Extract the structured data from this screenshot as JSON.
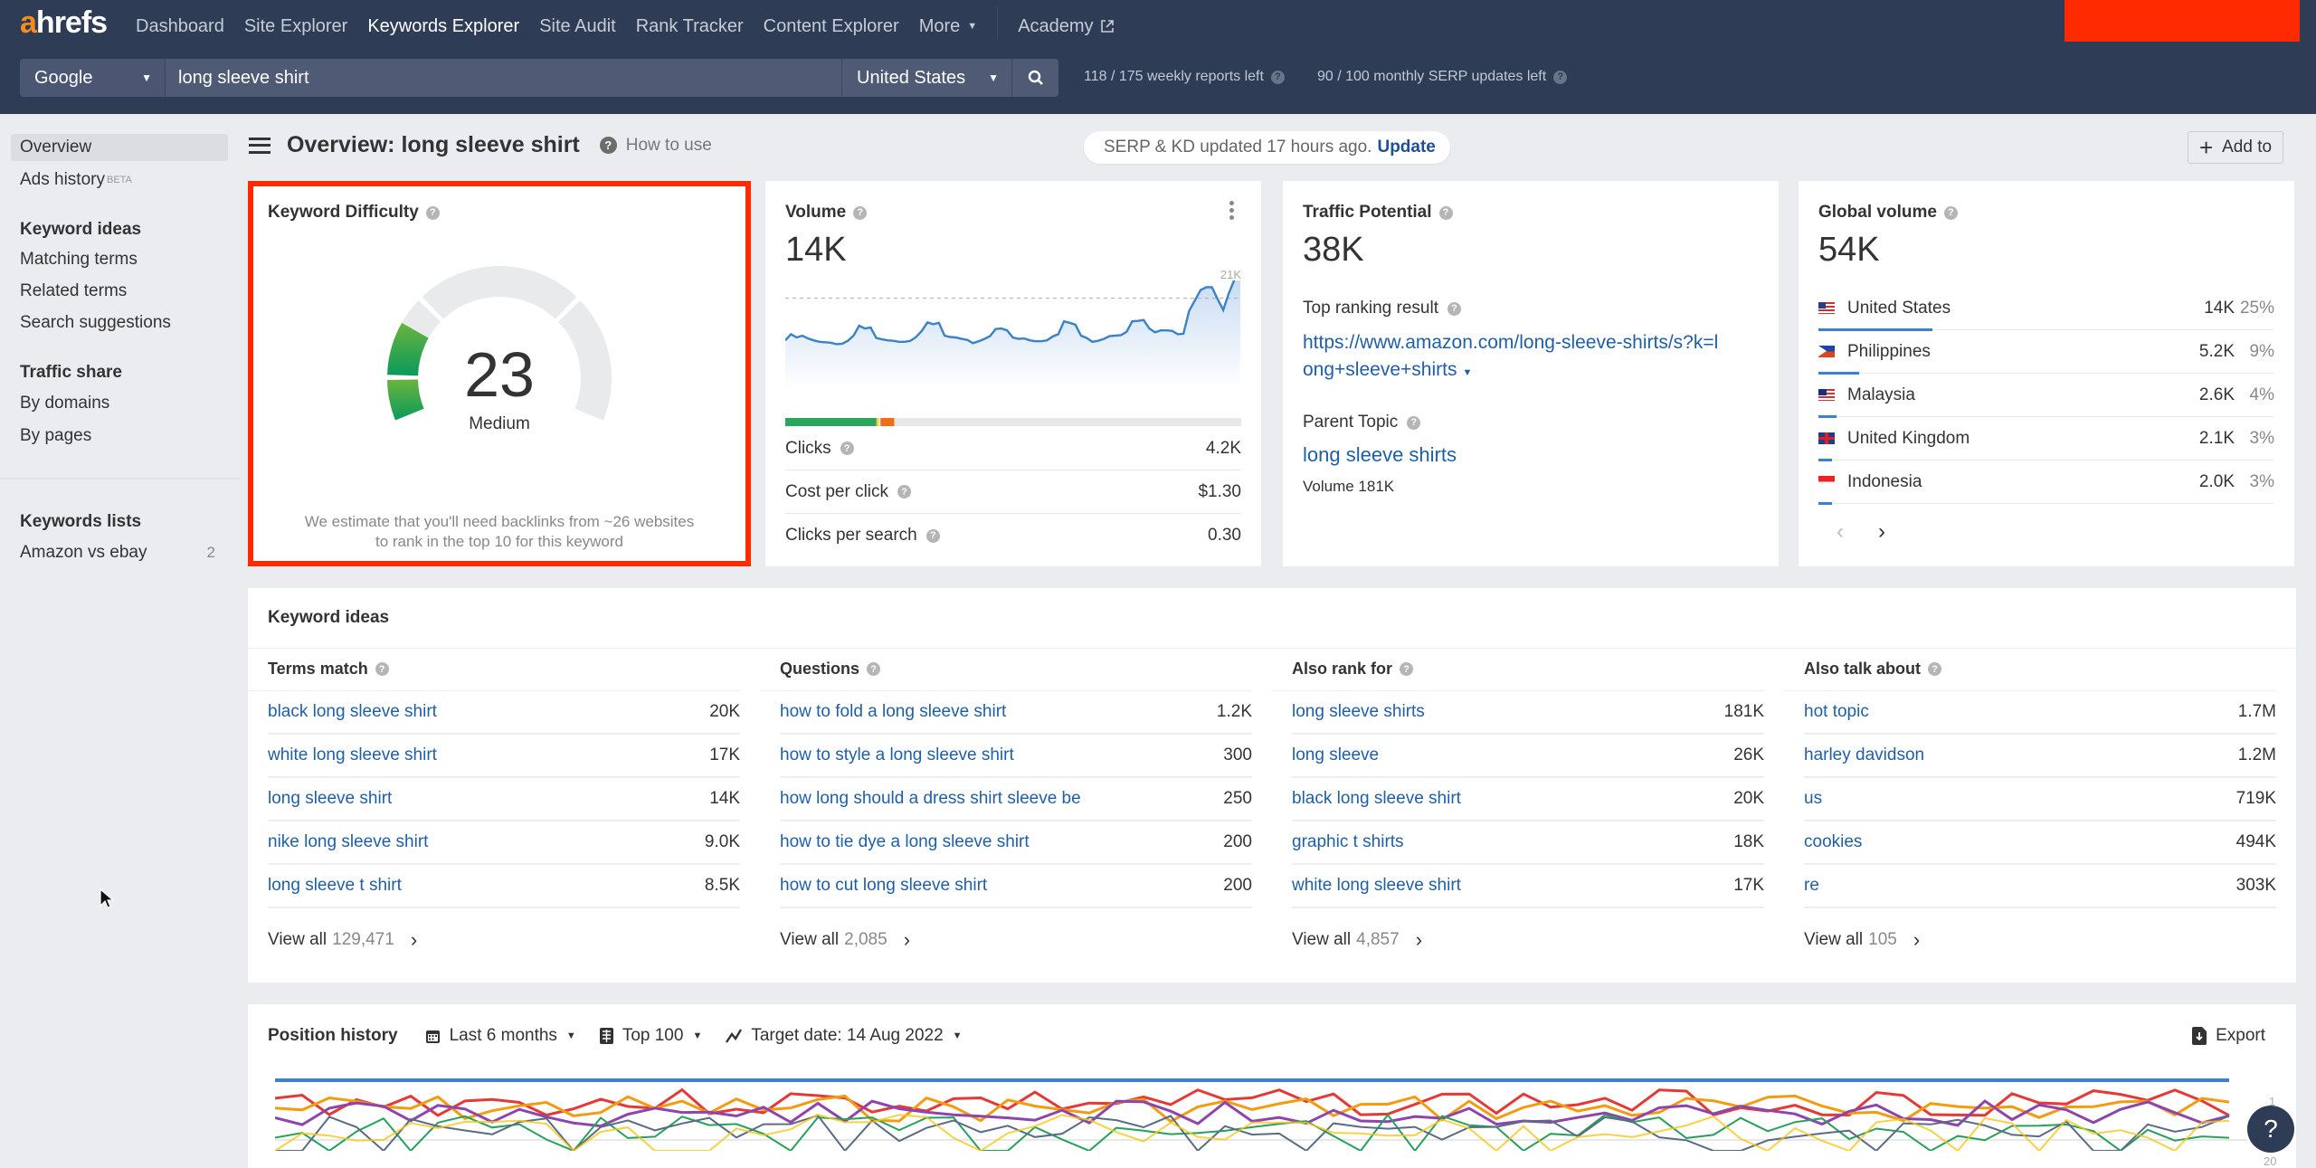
{
  "brand": {
    "logo_a": "a",
    "logo_rest": "hrefs"
  },
  "nav": {
    "items": [
      "Dashboard",
      "Site Explorer",
      "Keywords Explorer",
      "Site Audit",
      "Rank Tracker",
      "Content Explorer",
      "More"
    ],
    "active": "Keywords Explorer",
    "academy": "Academy"
  },
  "search": {
    "engine": "Google",
    "query": "long sleeve shirt",
    "country": "United States"
  },
  "quota": {
    "weekly": "118 / 175 weekly reports left",
    "monthly": "90 / 100 monthly SERP updates left"
  },
  "sidebar": {
    "overview": "Overview",
    "ads_history": "Ads history",
    "beta": "BETA",
    "keyword_ideas_head": "Keyword ideas",
    "matching_terms": "Matching terms",
    "related_terms": "Related terms",
    "search_suggestions": "Search suggestions",
    "traffic_share_head": "Traffic share",
    "by_domains": "By domains",
    "by_pages": "By pages",
    "keywords_lists_head": "Keywords lists",
    "list_name": "Amazon vs ebay",
    "list_count": "2"
  },
  "header": {
    "title": "Overview: long sleeve shirt",
    "how_to_use": "How to use",
    "serp_status": "SERP & KD updated 17 hours ago.",
    "update": "Update",
    "add_to": "Add to"
  },
  "kd": {
    "title": "Keyword Difficulty",
    "value": "23",
    "score": 23,
    "label": "Medium",
    "note_line1": "We estimate that you'll need backlinks from ~26 websites",
    "note_line2": "to rank in the top 10 for this keyword"
  },
  "volume": {
    "title": "Volume",
    "value": "14K",
    "max_label": "21K",
    "sparkline": [
      7.6,
      8.9,
      8.2,
      8.6,
      8.0,
      7.6,
      7.3,
      7.2,
      7.1,
      6.8,
      6.9,
      7.5,
      8.6,
      10.7,
      10.1,
      10.3,
      8.1,
      7.8,
      7.6,
      7.5,
      7.3,
      7.3,
      7.5,
      8.3,
      9.6,
      11.4,
      11.0,
      11.3,
      8.6,
      8.3,
      8.2,
      7.9,
      7.7,
      7.0,
      7.4,
      7.9,
      8.5,
      10.0,
      10.1,
      9.7,
      8.2,
      7.9,
      8.0,
      7.6,
      7.4,
      7.4,
      7.6,
      8.4,
      8.9,
      11.6,
      11.3,
      10.9,
      8.6,
      8.1,
      7.3,
      7.5,
      7.9,
      8.5,
      8.6,
      8.7,
      9.4,
      11.6,
      11.7,
      11.9,
      10.1,
      9.3,
      9.7,
      9.7,
      9.6,
      8.9,
      9.0,
      13.8,
      16.0,
      18.2,
      18.8,
      18.8,
      16.3,
      14.0,
      17.6,
      20.5,
      20.5
    ],
    "avg": 16.5,
    "ymax": 21,
    "clicks_bar": {
      "organic": 0.2,
      "mixed": 0.005,
      "paid": 0.03
    },
    "clicks_label": "Clicks",
    "clicks": "4.2K",
    "cpc_label": "Cost per click",
    "cpc": "$1.30",
    "cps_label": "Clicks per search",
    "cps": "0.30"
  },
  "traffic": {
    "title": "Traffic Potential",
    "value": "38K",
    "top_label": "Top ranking result",
    "top_url_line1": "https://www.amazon.com/long-sleeve-shirts/s?k=l",
    "top_url_line2": "ong+sleeve+shirts",
    "parent_label": "Parent Topic",
    "parent_topic": "long sleeve shirts",
    "parent_volume": "Volume 181K"
  },
  "global": {
    "title": "Global volume",
    "value": "54K",
    "countries": [
      {
        "name": "United States",
        "value": "14K",
        "pct": "25%",
        "share": 0.25
      },
      {
        "name": "Philippines",
        "value": "5.2K",
        "pct": "9%",
        "share": 0.09
      },
      {
        "name": "Malaysia",
        "value": "2.6K",
        "pct": "4%",
        "share": 0.04
      },
      {
        "name": "United Kingdom",
        "value": "2.1K",
        "pct": "3%",
        "share": 0.03
      },
      {
        "name": "Indonesia",
        "value": "2.0K",
        "pct": "3%",
        "share": 0.03
      }
    ]
  },
  "ideas": {
    "title": "Keyword ideas",
    "view_all": "View all",
    "columns": [
      {
        "title": "Terms match",
        "total": "129,471",
        "rows": [
          {
            "kw": "black long sleeve shirt",
            "v": "20K"
          },
          {
            "kw": "white long sleeve shirt",
            "v": "17K"
          },
          {
            "kw": "long sleeve shirt",
            "v": "14K"
          },
          {
            "kw": "nike long sleeve shirt",
            "v": "9.0K"
          },
          {
            "kw": "long sleeve t shirt",
            "v": "8.5K"
          }
        ]
      },
      {
        "title": "Questions",
        "total": "2,085",
        "rows": [
          {
            "kw": "how to fold a long sleeve shirt",
            "v": "1.2K"
          },
          {
            "kw": "how to style a long sleeve shirt",
            "v": "300"
          },
          {
            "kw": "how long should a dress shirt sleeve be",
            "v": "250"
          },
          {
            "kw": "how to tie dye a long sleeve shirt",
            "v": "200"
          },
          {
            "kw": "how to cut long sleeve shirt",
            "v": "200"
          }
        ]
      },
      {
        "title": "Also rank for",
        "total": "4,857",
        "rows": [
          {
            "kw": "long sleeve shirts",
            "v": "181K"
          },
          {
            "kw": "long sleeve",
            "v": "26K"
          },
          {
            "kw": "black long sleeve shirt",
            "v": "20K"
          },
          {
            "kw": "graphic t shirts",
            "v": "18K"
          },
          {
            "kw": "white long sleeve shirt",
            "v": "17K"
          }
        ]
      },
      {
        "title": "Also talk about",
        "total": "105",
        "rows": [
          {
            "kw": "hot topic",
            "v": "1.7M"
          },
          {
            "kw": "harley davidson",
            "v": "1.2M"
          },
          {
            "kw": "us",
            "v": "719K"
          },
          {
            "kw": "cookies",
            "v": "494K"
          },
          {
            "kw": "re",
            "v": "303K"
          }
        ]
      }
    ]
  },
  "position_history": {
    "title": "Position history",
    "range": "Last 6 months",
    "top": "Top 100",
    "target": "Target date: 14 Aug 2022",
    "export": "Export",
    "y_tick_top": "1",
    "y_tick_bottom": "20"
  },
  "help": "?"
}
